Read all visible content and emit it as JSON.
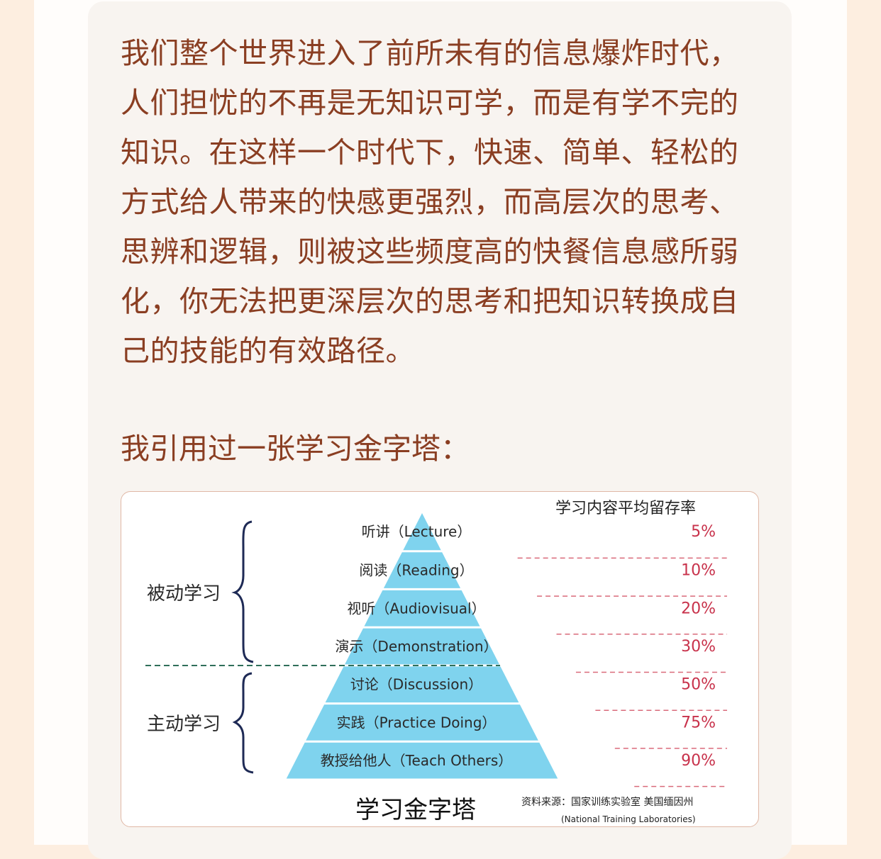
{
  "article": {
    "paragraph": "我们整个世界进入了前所未有的信息爆炸时代，人们担忧的不再是无知识可学，而是有学不完的知识。在这样一个时代下，快速、简单、轻松的方式给人带来的快感更强烈，而高层次的思考、思辨和逻辑，则被这些频度高的快餐信息感所弱化，你无法把更深层次的思考和把知识转换成自己的技能的有效路径。",
    "intro": "我引用过一张学习金字塔："
  },
  "figure": {
    "header": "学习内容平均留存率",
    "title": "学习金字塔",
    "source_line1": "资料来源：国家训练实验室 美国缅因州",
    "source_line2": "(National Training Laboratories)",
    "groups": [
      {
        "label": "被动学习"
      },
      {
        "label": "主动学习"
      }
    ],
    "levels": [
      {
        "label": "听讲（Lecture）",
        "pct": "5%"
      },
      {
        "label": "阅读（Reading）",
        "pct": "10%"
      },
      {
        "label": "视听（Audiovisual）",
        "pct": "20%"
      },
      {
        "label": "演示（Demonstration）",
        "pct": "30%"
      },
      {
        "label": "讨论（Discussion）",
        "pct": "50%"
      },
      {
        "label": "实践（Practice Doing）",
        "pct": "75%"
      },
      {
        "label": "教授给他人（Teach Others）",
        "pct": "90%"
      }
    ],
    "colors": {
      "pyramid": "#7fd3ee",
      "dashed_red": "#d96a7a",
      "divider_green": "#2f6f5a",
      "brace": "#1e2a55",
      "text": "#8a3e22"
    }
  }
}
